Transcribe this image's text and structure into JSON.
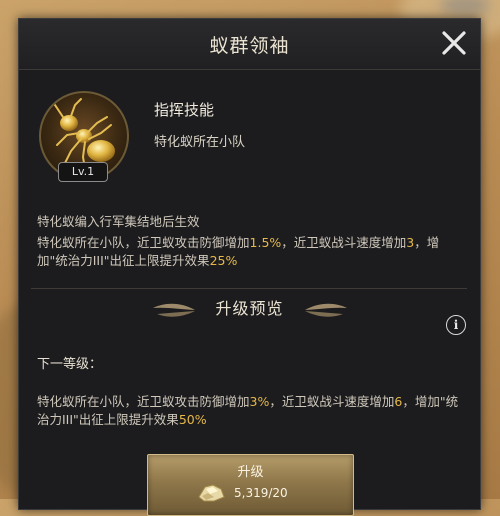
{
  "window": {
    "title": "蚁群领袖"
  },
  "skill": {
    "level_badge": "Lv.1",
    "type": "指挥技能",
    "target": "特化蚁所在小队"
  },
  "effect": {
    "condition": "特化蚁编入行军集结地后生效",
    "desc_parts": [
      "特化蚁所在小队，近卫蚁攻击防御增加",
      "1.5%",
      "，近卫蚁战斗速度增加",
      "3",
      "，增加\"统治力III\"出征上限提升效果",
      "25%"
    ]
  },
  "upgrade_preview": {
    "title": "升级预览",
    "next_level_label": "下一等级：",
    "desc_parts": [
      "特化蚁所在小队，近卫蚁攻击防御增加",
      "3%",
      "，近卫蚁战斗速度增加",
      "6",
      "，增加\"统治力III\"出征上限提升效果",
      "50%"
    ]
  },
  "upgrade_button": {
    "label": "升级",
    "cost": "5,319/20"
  },
  "icons": {
    "close": "close-icon",
    "info": "info-icon",
    "portrait": "golden-ant-icon",
    "resource": "gold-ore-icon"
  },
  "colors": {
    "highlight": "#e6b84a",
    "panel": "#1c1c1e",
    "button": "#8f774a"
  }
}
